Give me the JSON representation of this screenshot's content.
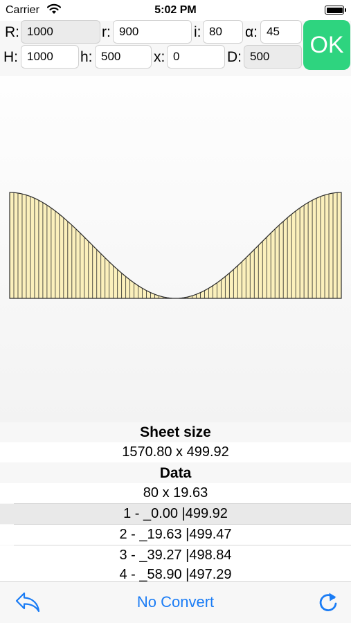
{
  "status_bar": {
    "carrier": "Carrier",
    "time": "5:02 PM"
  },
  "params": {
    "R": {
      "label": "R:",
      "value": "1000"
    },
    "r": {
      "label": "r:",
      "value": "900"
    },
    "i": {
      "label": "i:",
      "value": "80"
    },
    "alpha": {
      "label": "α:",
      "value": "45"
    },
    "H": {
      "label": "H:",
      "value": "1000"
    },
    "h": {
      "label": "h:",
      "value": "500"
    },
    "x": {
      "label": "x:",
      "value": "0"
    },
    "D": {
      "label": "D:",
      "value": "500"
    }
  },
  "ok_label": "OK",
  "drawing": {
    "stripe_count": 80,
    "fill_color": "#fbf0bc",
    "line_color": "#2a2a2a"
  },
  "sheet_size": {
    "title": "Sheet size",
    "value": "1570.80 x 499.92"
  },
  "data": {
    "title": "Data",
    "summary": "80 x 19.63",
    "rows": [
      "1 - _0.00 |499.92",
      "2 - _19.63 |499.47",
      "3 - _39.27 |498.84",
      "4 - _58.90 |497.29"
    ]
  },
  "toolbar": {
    "center_label": "No Convert",
    "accent": "#1a7cf5"
  }
}
